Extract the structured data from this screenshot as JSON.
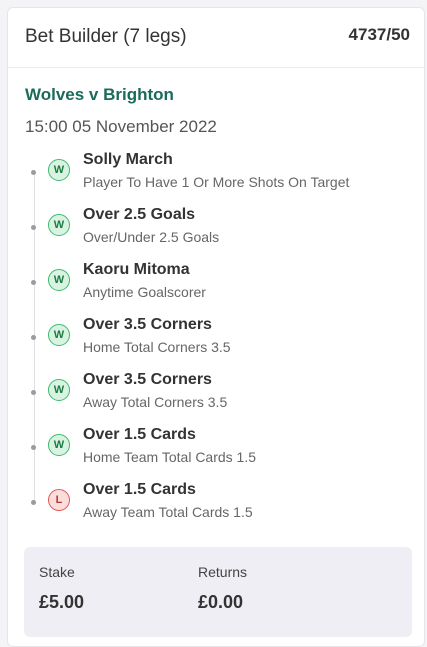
{
  "header": {
    "title": "Bet Builder (7 legs)",
    "odds": "4737/50"
  },
  "event": {
    "match": "Wolves v Brighton",
    "datetime": "15:00 05 November 2022"
  },
  "legs": [
    {
      "result": "W",
      "selection": "Solly March",
      "market": "Player To Have 1 Or More Shots On Target"
    },
    {
      "result": "W",
      "selection": "Over 2.5 Goals",
      "market": "Over/Under 2.5 Goals"
    },
    {
      "result": "W",
      "selection": "Kaoru Mitoma",
      "market": "Anytime Goalscorer"
    },
    {
      "result": "W",
      "selection": "Over 3.5 Corners",
      "market": "Home Total Corners 3.5"
    },
    {
      "result": "W",
      "selection": "Over 3.5 Corners",
      "market": "Away Total Corners 3.5"
    },
    {
      "result": "W",
      "selection": "Over 1.5 Cards",
      "market": "Home Team Total Cards 1.5"
    },
    {
      "result": "L",
      "selection": "Over 1.5 Cards",
      "market": "Away Team Total Cards 1.5"
    }
  ],
  "summary": {
    "stake_label": "Stake",
    "stake_value": "£5.00",
    "returns_label": "Returns",
    "returns_value": "£0.00"
  },
  "colors": {
    "match_green": "#1a6b5a",
    "win_green": "#3dbb6b",
    "loss_red": "#e05a52"
  }
}
